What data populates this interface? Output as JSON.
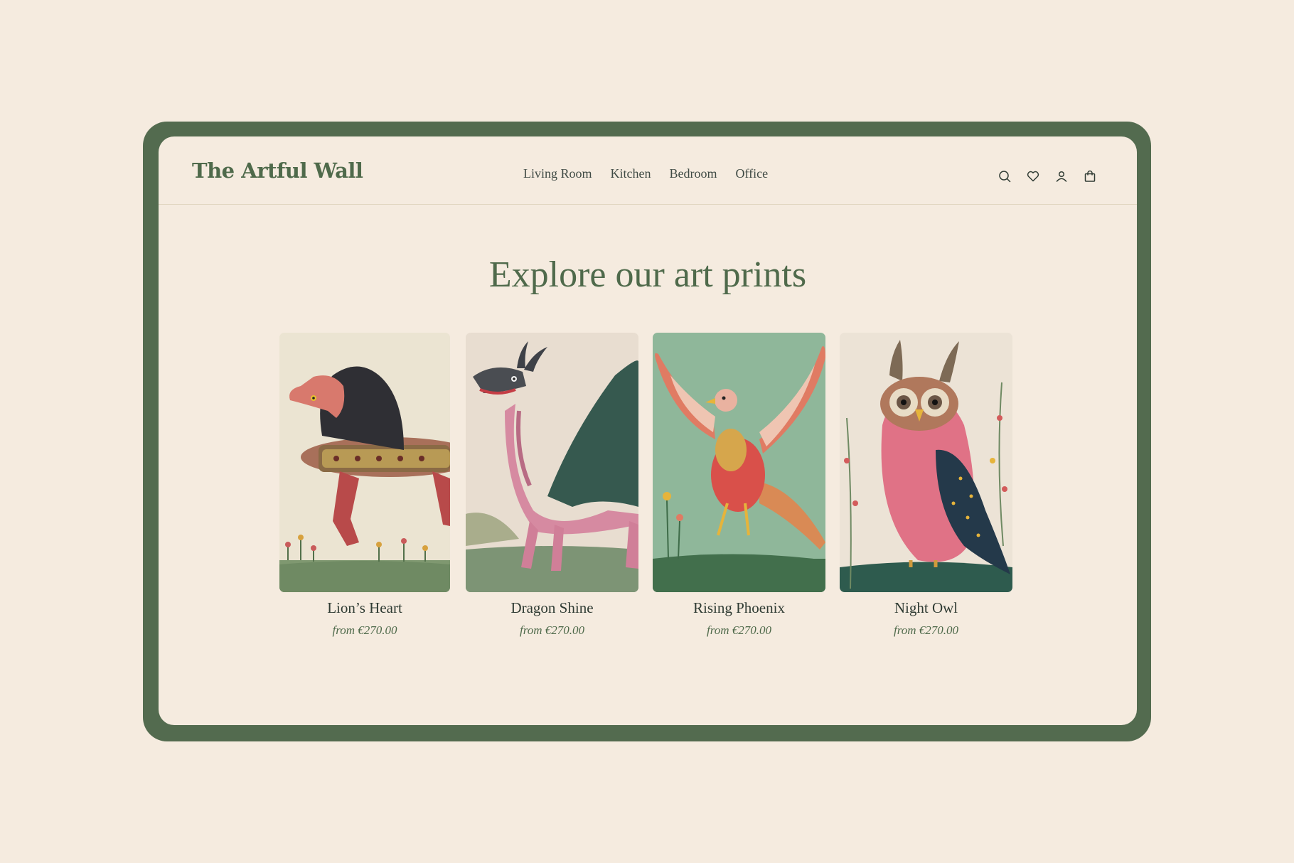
{
  "header": {
    "logo": "The Artful Wall",
    "nav": [
      "Living Room",
      "Kitchen",
      "Bedroom",
      "Office"
    ],
    "icons": [
      "search-icon",
      "heart-icon",
      "user-icon",
      "shopping-bag-icon"
    ]
  },
  "main": {
    "title": "Explore our art prints",
    "products": [
      {
        "name": "Lion’s Heart",
        "price": "from €270.00"
      },
      {
        "name": "Dragon Shine",
        "price": "from €270.00"
      },
      {
        "name": "Rising Phoenix",
        "price": "from €270.00"
      },
      {
        "name": "Night Owl",
        "price": "from €270.00"
      }
    ]
  },
  "colors": {
    "brand_green": "#4f6a4b",
    "frame_green": "#536b4f",
    "background": "#f5ebdf",
    "text": "#2f3b33"
  }
}
